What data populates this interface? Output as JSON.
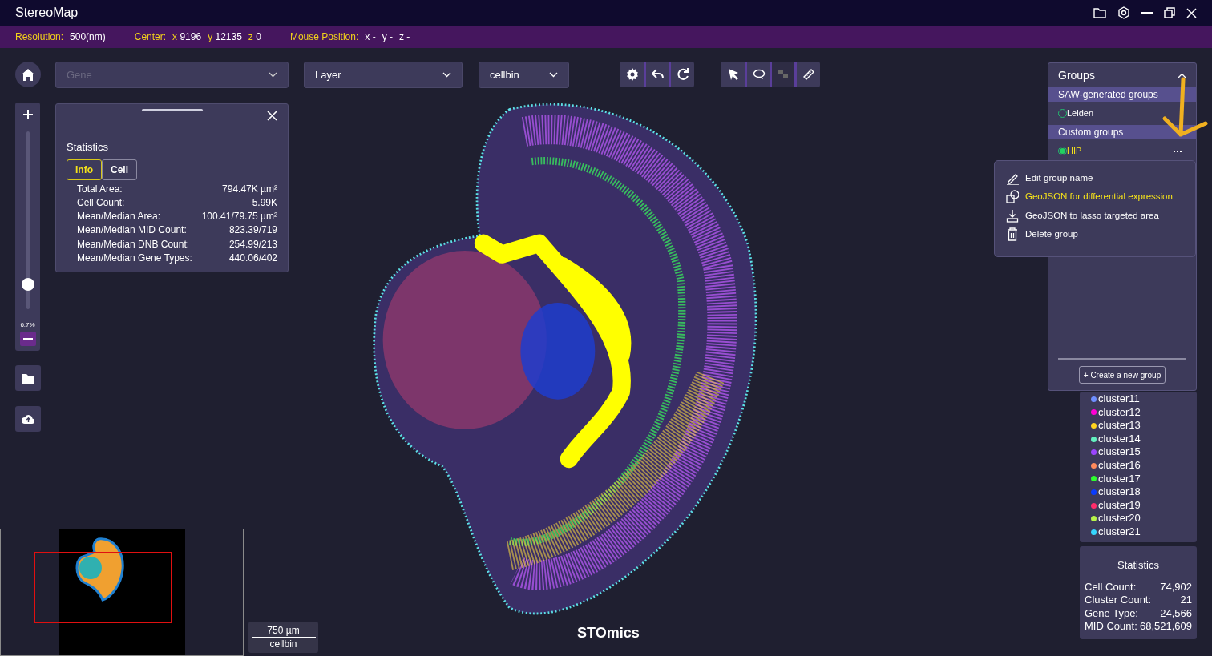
{
  "window": {
    "title": "StereoMap"
  },
  "info_bar": [
    {
      "label": "Resolution:",
      "coords": [
        {
          "value": "500(nm)"
        }
      ]
    },
    {
      "label": "Center:",
      "coords": [
        {
          "axis": "x",
          "value": "9196"
        },
        {
          "axis": "y",
          "value": "12135"
        },
        {
          "axis": "z",
          "value": "0"
        }
      ],
      "axis_highlight": true
    },
    {
      "label": "Mouse Position:",
      "coords": [
        {
          "axis": "x",
          "value": "-"
        },
        {
          "axis": "y",
          "value": "-"
        },
        {
          "axis": "z",
          "value": "-"
        }
      ],
      "axis_highlight": false
    }
  ],
  "toolbar": {
    "gene_select": {
      "placeholder": "Gene",
      "disabled": true
    },
    "layer_select": {
      "value": "Layer"
    },
    "bin_select": {
      "value": "cellbin"
    },
    "tool_groups": [
      [
        {
          "kind": "settings",
          "disabled": false
        },
        {
          "kind": "undo",
          "disabled": false
        },
        {
          "kind": "redo",
          "disabled": false
        }
      ],
      [
        {
          "kind": "select",
          "disabled": false
        },
        {
          "kind": "lasso",
          "disabled": false
        },
        {
          "kind": "grid",
          "disabled": true
        },
        {
          "kind": "ruler",
          "disabled": false
        }
      ]
    ]
  },
  "zoom": {
    "level": 0.14,
    "reading": "6.7%"
  },
  "statistics_panel": {
    "title": "Statistics",
    "tabs": [
      {
        "label": "Info",
        "selected": true
      },
      {
        "label": "Cell",
        "selected": false
      }
    ],
    "rows": [
      {
        "label": "Total Area:",
        "value": "794.47K µm²"
      },
      {
        "label": "Cell Count:",
        "value": "5.99K"
      },
      {
        "label": "Mean/Median Area:",
        "value": "100.41/79.75 µm²"
      },
      {
        "label": "Mean/Median MID Count:",
        "value": "823.39/719"
      },
      {
        "label": "Mean/Median DNB Count:",
        "value": "254.99/213"
      },
      {
        "label": "Mean/Median Gene Types:",
        "value": "440.06/402"
      }
    ]
  },
  "groups_panel": {
    "title": "Groups",
    "expanded": true,
    "sections": [
      {
        "title": "SAW-generated groups",
        "groups": [
          {
            "name": "Leiden",
            "selected": false
          }
        ]
      },
      {
        "title": "Custom groups",
        "groups": [
          {
            "name": "HIP",
            "selected": true
          }
        ]
      }
    ],
    "context_menu": [
      {
        "kind": "edit",
        "label": "Edit group name",
        "highlighted": false
      },
      {
        "kind": "geojson",
        "label": "GeoJSON for differential expression",
        "highlighted": true
      },
      {
        "kind": "download",
        "label": "GeoJSON to lasso targeted area",
        "highlighted": false
      },
      {
        "kind": "delete",
        "label": "Delete group",
        "highlighted": false
      }
    ],
    "create_button": "+ Create a new group"
  },
  "legend": [
    {
      "name": "cluster11",
      "color": "#6f8fff"
    },
    {
      "name": "cluster12",
      "color": "#ff00d4"
    },
    {
      "name": "cluster13",
      "color": "#ffd21f"
    },
    {
      "name": "cluster14",
      "color": "#63f0c0"
    },
    {
      "name": "cluster15",
      "color": "#9b45ff"
    },
    {
      "name": "cluster16",
      "color": "#ff8a5c"
    },
    {
      "name": "cluster17",
      "color": "#2eff2e"
    },
    {
      "name": "cluster18",
      "color": "#0a3bff"
    },
    {
      "name": "cluster19",
      "color": "#ff2d6b"
    },
    {
      "name": "cluster20",
      "color": "#b8f54a"
    },
    {
      "name": "cluster21",
      "color": "#36d6ff"
    }
  ],
  "summary_statistics": {
    "title": "Statistics",
    "rows": [
      {
        "label": "Cell Count:",
        "value": "74,902"
      },
      {
        "label": "Cluster Count:",
        "value": "21"
      },
      {
        "label": "Gene Type:",
        "value": "24,566"
      },
      {
        "label": "MID Count:",
        "value": "68,521,609"
      }
    ]
  },
  "scale_bar": {
    "distance": "750 µm",
    "mode": "cellbin"
  },
  "canvas_logo": "STOmics"
}
